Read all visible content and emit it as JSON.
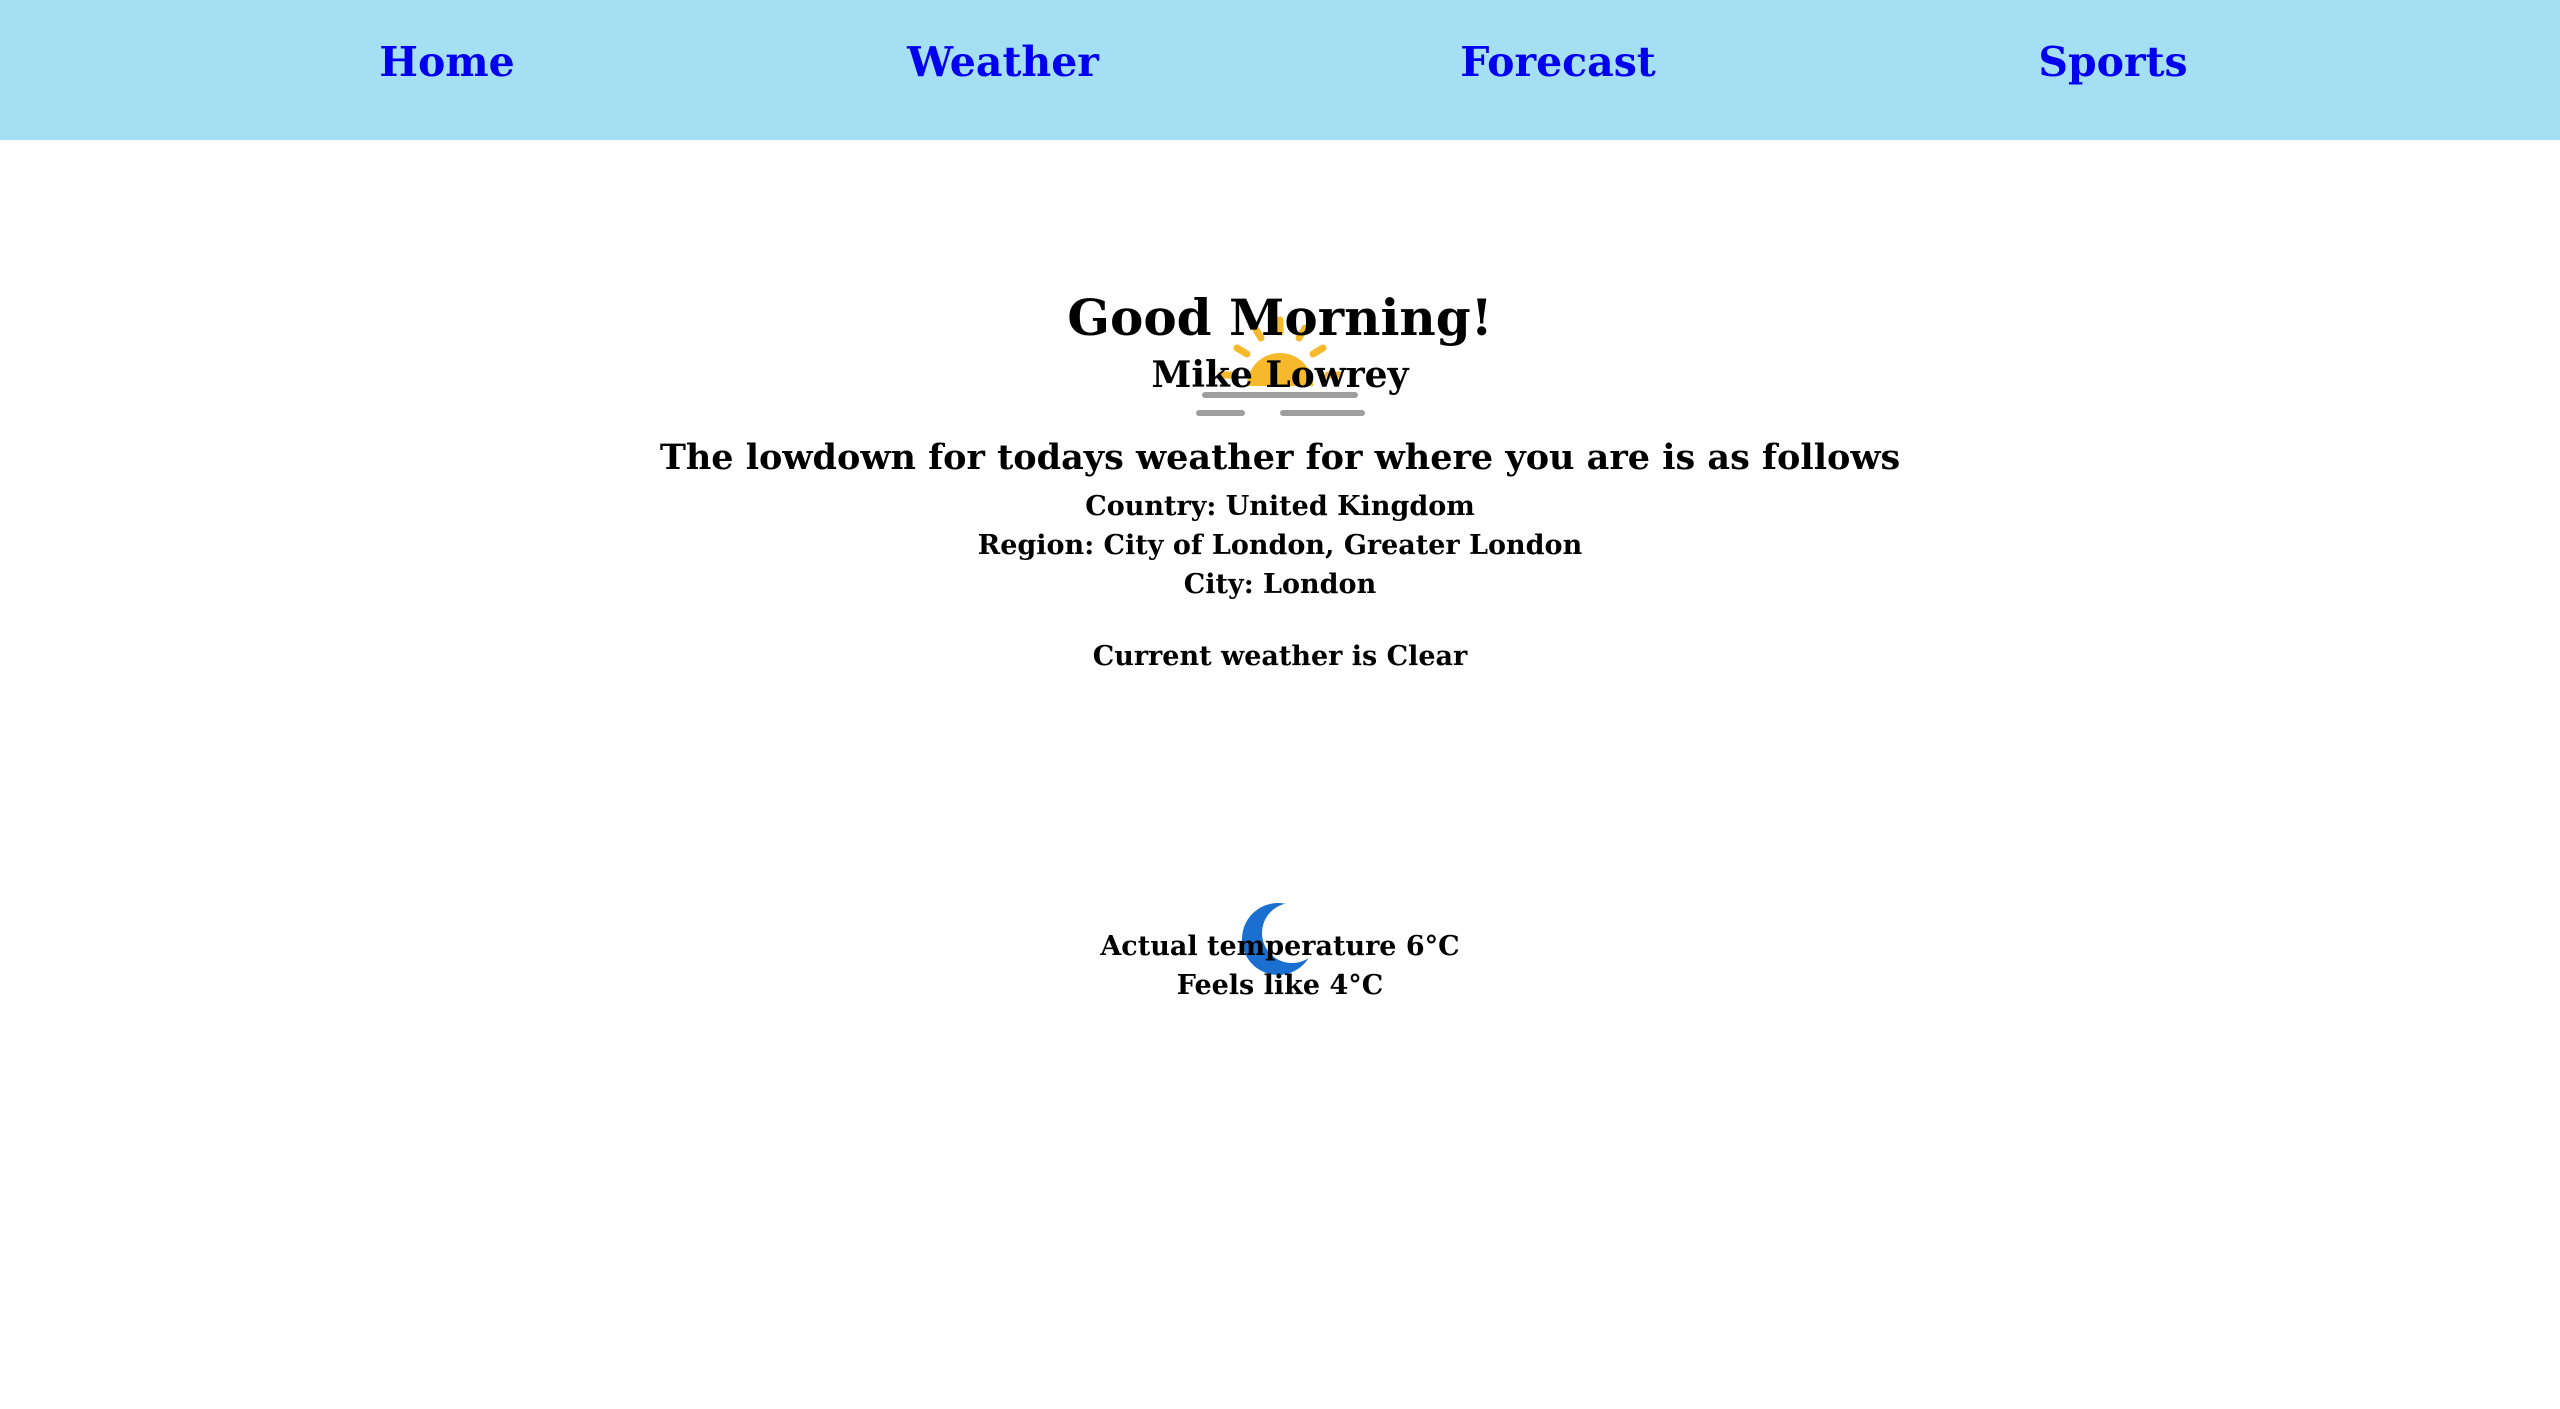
{
  "nav": {
    "items": [
      {
        "label": "Home"
      },
      {
        "label": "Weather"
      },
      {
        "label": "Forecast"
      },
      {
        "label": "Sports"
      }
    ],
    "link_color": "#0000ee",
    "background": "#a5dff3"
  },
  "greeting": {
    "icon": "sunrise-icon",
    "title": "Good Morning!",
    "name": "Mike Lowrey"
  },
  "location": {
    "heading": "The lowdown for todays weather for where you are is as follows",
    "country": "Country: United Kingdom",
    "region": "Region: City of London, Greater London",
    "city": "City: London"
  },
  "weather": {
    "current": "Current weather is Clear",
    "icon": "moon-icon",
    "icon_color": "#1a6fd0",
    "actual_temperature": "Actual temperature 6°C",
    "feels_like": "Feels like 4°C"
  }
}
